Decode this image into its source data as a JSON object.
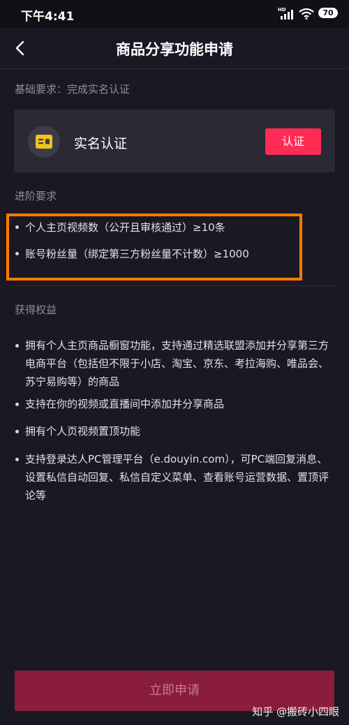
{
  "status_bar": {
    "time": "下午4:41",
    "network": "HD",
    "battery": "70"
  },
  "nav": {
    "title": "商品分享功能申请"
  },
  "basic": {
    "label": "基础要求：完成实名认证",
    "card_title": "实名认证",
    "button_label": "认证"
  },
  "advanced": {
    "label": "进阶要求",
    "items": [
      "个人主页视频数（公开且审核通过）≥10条",
      "账号粉丝量（绑定第三方粉丝量不计数）≥1000"
    ]
  },
  "benefits": {
    "label": "获得权益",
    "items": [
      "拥有个人主页商品橱窗功能，支持通过精选联盟添加并分享第三方电商平台（包括但不限于小店、淘宝、京东、考拉海购、唯品会、苏宁易购等）的商品",
      "支持在你的视频或直播间中添加并分享商品",
      "拥有个人页视频置顶功能",
      "支持登录达人PC管理平台（e.douyin.com），可PC端回复消息、设置私信自动回复、私信自定义菜单、查看账号运营数据、置顶评论等"
    ]
  },
  "footer": {
    "apply_label": "立即申请",
    "watermark": "知乎 @搬砖小四眼"
  },
  "colors": {
    "background": "#1a1923",
    "accent": "#fe2c55",
    "highlight": "#ff7a00",
    "apply_disabled": "#8a1d3c"
  },
  "icons": [
    "back-arrow-icon",
    "id-card-icon",
    "signal-icon",
    "wifi-icon",
    "battery-icon"
  ]
}
